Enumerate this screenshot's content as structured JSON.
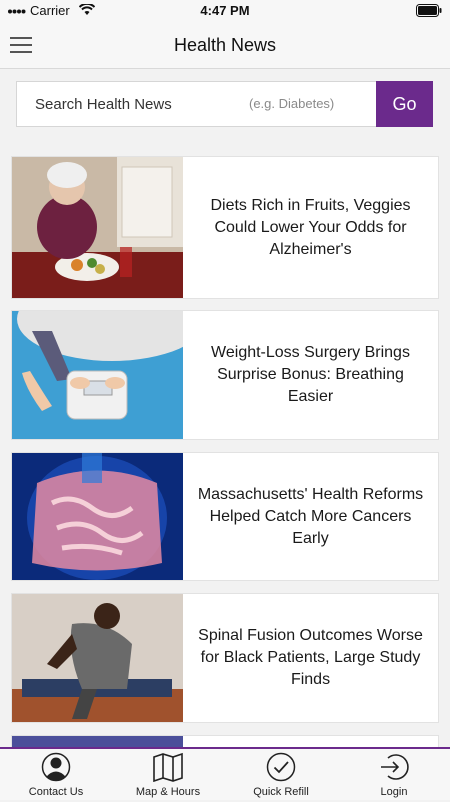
{
  "status_bar": {
    "carrier": "Carrier",
    "time": "4:47 PM"
  },
  "nav": {
    "title": "Health News"
  },
  "search": {
    "label": "Search Health News",
    "placeholder": "(e.g. Diabetes)",
    "button": "Go"
  },
  "articles": [
    {
      "headline": "Diets Rich in Fruits, Veggies Could Lower Your Odds for Alzheimer's",
      "image": "elderly-woman-eating-icon"
    },
    {
      "headline": "Weight-Loss Surgery Brings Surprise Bonus: Breathing Easier",
      "image": "bathroom-scale-icon"
    },
    {
      "headline": "Massachusetts' Health Reforms Helped Catch More Cancers Early",
      "image": "intestines-xray-icon"
    },
    {
      "headline": "Spinal Fusion Outcomes Worse for Black Patients, Large Study Finds",
      "image": "back-pain-man-icon"
    }
  ],
  "tab_bar": {
    "tabs": [
      {
        "label": "Contact Us",
        "icon": "person-icon"
      },
      {
        "label": "Map & Hours",
        "icon": "map-icon"
      },
      {
        "label": "Quick Refill",
        "icon": "check-circle-icon"
      },
      {
        "label": "Login",
        "icon": "login-icon"
      }
    ]
  },
  "colors": {
    "accent": "#6b2a8c"
  }
}
